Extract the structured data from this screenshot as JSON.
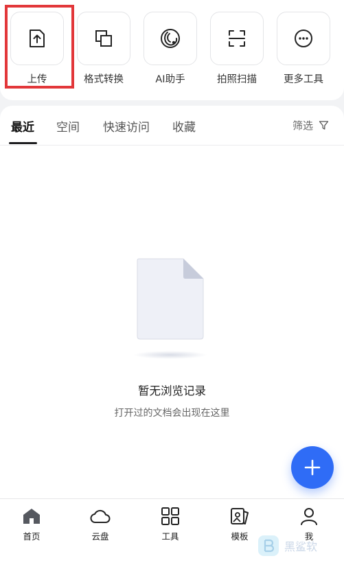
{
  "tools": [
    {
      "label": "上传",
      "icon": "upload-icon"
    },
    {
      "label": "格式转换",
      "icon": "convert-icon"
    },
    {
      "label": "AI助手",
      "icon": "ai-assistant-icon"
    },
    {
      "label": "拍照扫描",
      "icon": "scan-icon"
    },
    {
      "label": "更多工具",
      "icon": "more-icon"
    }
  ],
  "tabs": [
    {
      "label": "最近",
      "active": true
    },
    {
      "label": "空间",
      "active": false
    },
    {
      "label": "快速访问",
      "active": false
    },
    {
      "label": "收藏",
      "active": false
    }
  ],
  "filter_label": "筛选",
  "empty": {
    "title": "暂无浏览记录",
    "subtitle": "打开过的文档会出现在这里"
  },
  "bottom_nav": [
    {
      "label": "首页",
      "icon": "home-icon",
      "active": true
    },
    {
      "label": "云盘",
      "icon": "cloud-icon",
      "active": false
    },
    {
      "label": "工具",
      "icon": "tools-grid-icon",
      "active": false
    },
    {
      "label": "模板",
      "icon": "template-icon",
      "active": false
    },
    {
      "label": "我",
      "icon": "user-icon",
      "active": false
    }
  ],
  "watermark_text": "黑鲨软",
  "colors": {
    "accent": "#2f6cf6",
    "highlight": "#e2373a"
  }
}
